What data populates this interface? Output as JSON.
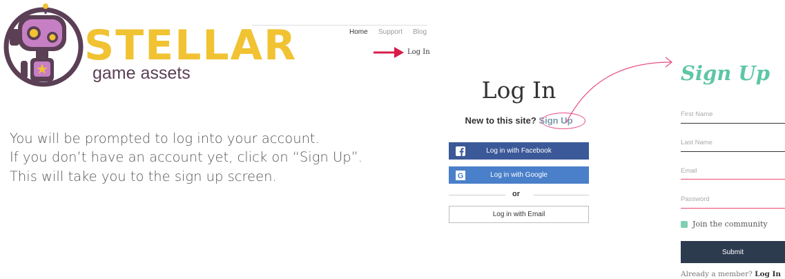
{
  "brand": {
    "title": "STELLAR",
    "subtitle": "game assets",
    "colors": {
      "title": "#f1c232",
      "robot": "#5a3f55",
      "robot_face": "#c77fc4"
    }
  },
  "nav": {
    "items": [
      "Home",
      "Support",
      "Blog"
    ],
    "login": "Log In"
  },
  "instructions": [
    "You will be prompted to log into your account.",
    "If you don’t have an account yet, click on “Sign Up”.",
    "This will take you to the sign up screen."
  ],
  "login": {
    "title": "Log In",
    "new_prefix": "New to this site?",
    "signup_link": "Sign Up",
    "facebook": "Log in with Facebook",
    "google": "Log in with Google",
    "or": "or",
    "email": "Log in with Email"
  },
  "signup": {
    "title": "Sign Up",
    "first_name": "First Name",
    "last_name": "Last Name",
    "email": "Email",
    "password": "Password",
    "join": "Join the community",
    "submit": "Submit",
    "already": "Already a member?",
    "login_link": "Log In"
  },
  "colors": {
    "accent_pink": "#e84b84",
    "facebook": "#3b5998",
    "google": "#4a7fc9",
    "signup_green": "#5ec6a7",
    "submit_bg": "#2d3b4f"
  },
  "icons": [
    "robot-logo-icon",
    "red-arrow-icon",
    "facebook-icon",
    "google-icon",
    "curved-arrow-icon"
  ]
}
